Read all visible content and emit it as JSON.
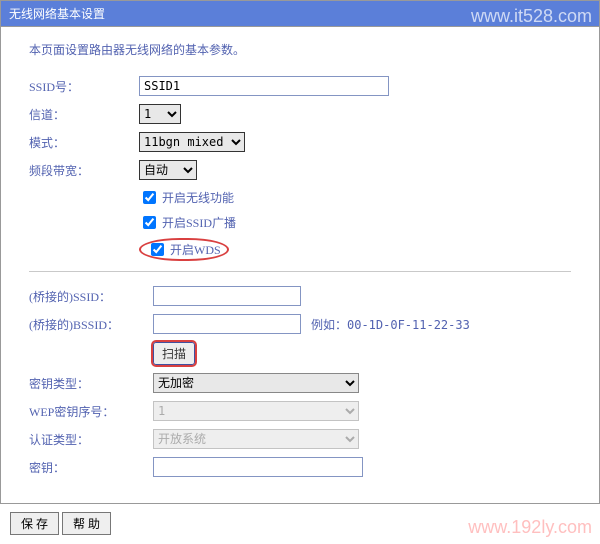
{
  "title": "无线网络基本设置",
  "intro": "本页面设置路由器无线网络的基本参数。",
  "labels": {
    "ssid": "SSID号：",
    "channel": "信道：",
    "mode": "模式：",
    "bandwidth": "频段带宽：",
    "enable_wireless": "开启无线功能",
    "enable_ssid_broadcast": "开启SSID广播",
    "enable_wds": "开启WDS",
    "bridge_ssid": "(桥接的)SSID：",
    "bridge_bssid": "(桥接的)BSSID：",
    "bssid_hint": "例如：00-1D-0F-11-22-33",
    "scan": "扫描",
    "encryption": "密钥类型：",
    "wep_index": "WEP密钥序号：",
    "auth_type": "认证类型：",
    "key": "密钥："
  },
  "values": {
    "ssid": "SSID1",
    "channel": "1",
    "mode": "11bgn mixed",
    "bandwidth": "自动",
    "enable_wireless": true,
    "enable_ssid_broadcast": true,
    "enable_wds": true,
    "bridge_ssid": "",
    "bridge_bssid": "",
    "encryption": "无加密",
    "wep_index": "1",
    "auth_type": "开放系统",
    "key": ""
  },
  "buttons": {
    "save": "保 存",
    "help": "帮 助"
  },
  "watermarks": {
    "top": "www.it528.com",
    "bottom": "www.192ly.com"
  }
}
